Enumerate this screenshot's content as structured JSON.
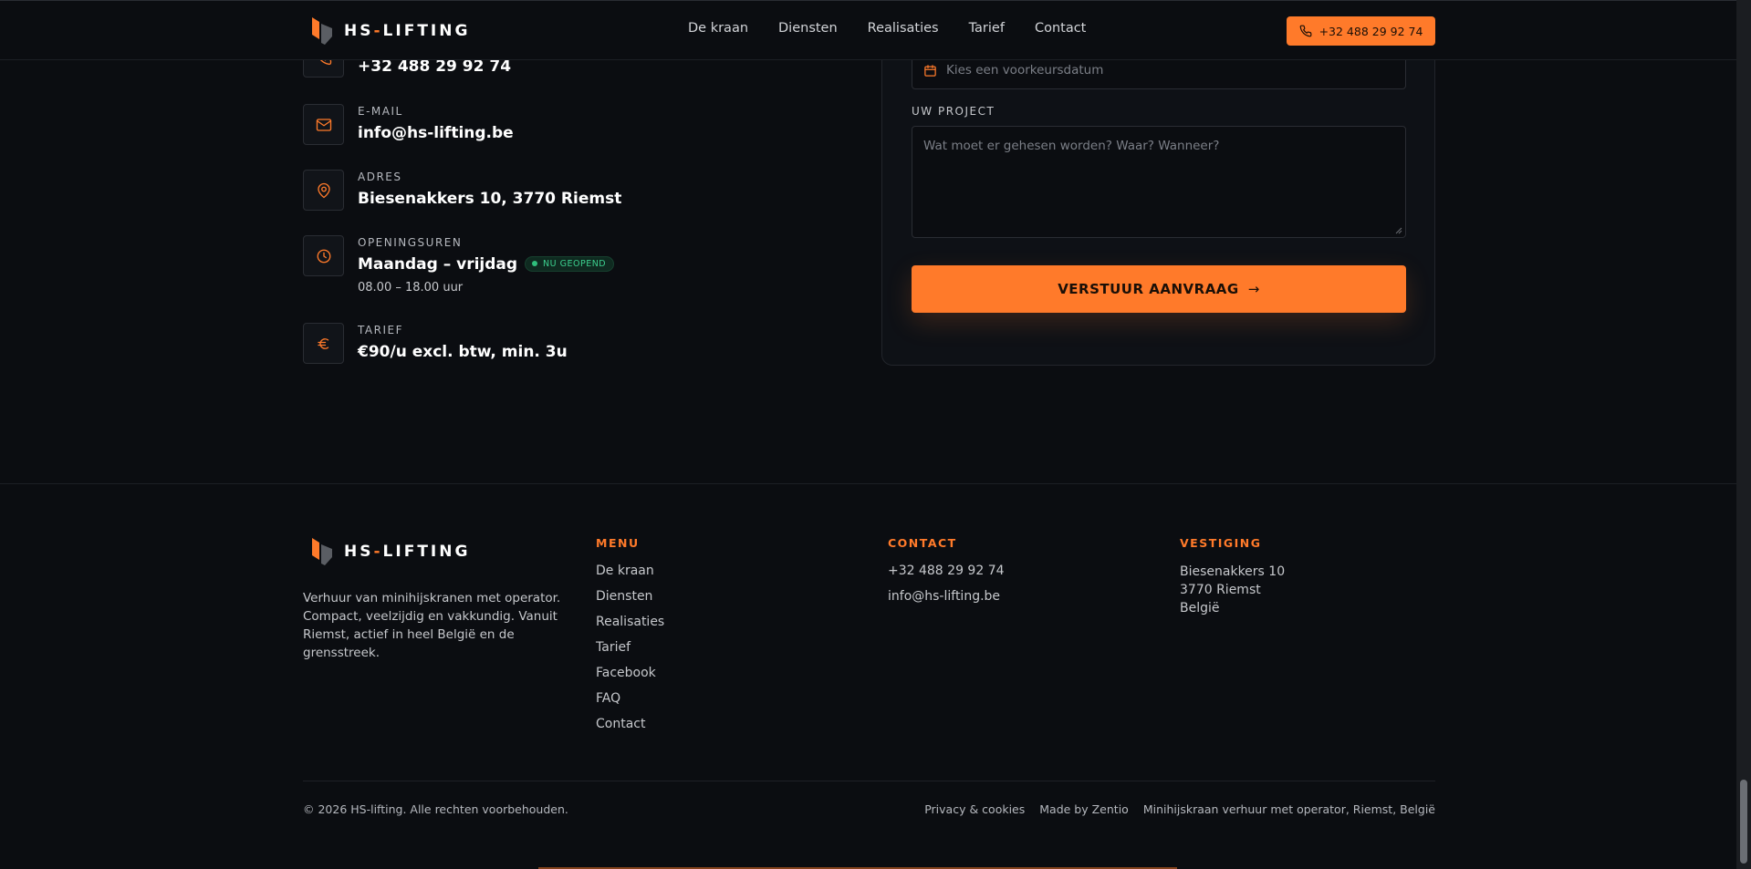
{
  "header": {
    "brand_main": "HS",
    "brand_dash": "-",
    "brand_rest": "LIFTING",
    "nav": [
      "De kraan",
      "Diensten",
      "Realisaties",
      "Tarief",
      "Contact"
    ],
    "cta_phone": "+32 488 29 92 74",
    "accent_color": "#ff7a2a"
  },
  "contact_info": {
    "phone": {
      "value": "+32 488 29 92 74",
      "icon": "phone-icon"
    },
    "email": {
      "label": "E-MAIL",
      "value": "info@hs-lifting.be",
      "icon": "mail-icon"
    },
    "address": {
      "label": "ADRES",
      "value": "Biesenakkers 10, 3770 Riemst",
      "icon": "map-pin-icon"
    },
    "hours": {
      "label": "OPENINGSUREN",
      "value": "Maandag – vrijdag",
      "badge": "NU GEOPEND",
      "sub": "08.00 – 18.00 uur",
      "icon": "clock-icon"
    },
    "rate": {
      "label": "TARIEF",
      "value": "€90/u excl. btw, min. 3u",
      "icon": "euro-icon"
    }
  },
  "form": {
    "date_placeholder": "Kies een voorkeursdatum",
    "project_label": "UW PROJECT",
    "project_placeholder": "Wat moet er gehesen worden? Waar? Wanneer?",
    "submit_label": "VERSTUUR AANVRAAG",
    "submit_arrow": "→"
  },
  "footer": {
    "description": "Verhuur van minihijskranen met operator. Compact, veelzijdig en vakkundig. Vanuit Riemst, actief in heel België en de grensstreek.",
    "menu_heading": "MENU",
    "menu": [
      "De kraan",
      "Diensten",
      "Realisaties",
      "Tarief",
      "Facebook",
      "FAQ",
      "Contact"
    ],
    "contact_heading": "CONTACT",
    "contact": [
      "+32 488 29 92 74",
      "info@hs-lifting.be"
    ],
    "location_heading": "VESTIGING",
    "location": [
      "Biesenakkers 10",
      "3770 Riemst",
      "België"
    ],
    "copyright": "© 2026 HS-lifting. Alle rechten voorbehouden.",
    "legal": [
      "Privacy & cookies",
      "Made by Zentio",
      "Minihijskraan verhuur met operator, Riemst, België"
    ]
  }
}
